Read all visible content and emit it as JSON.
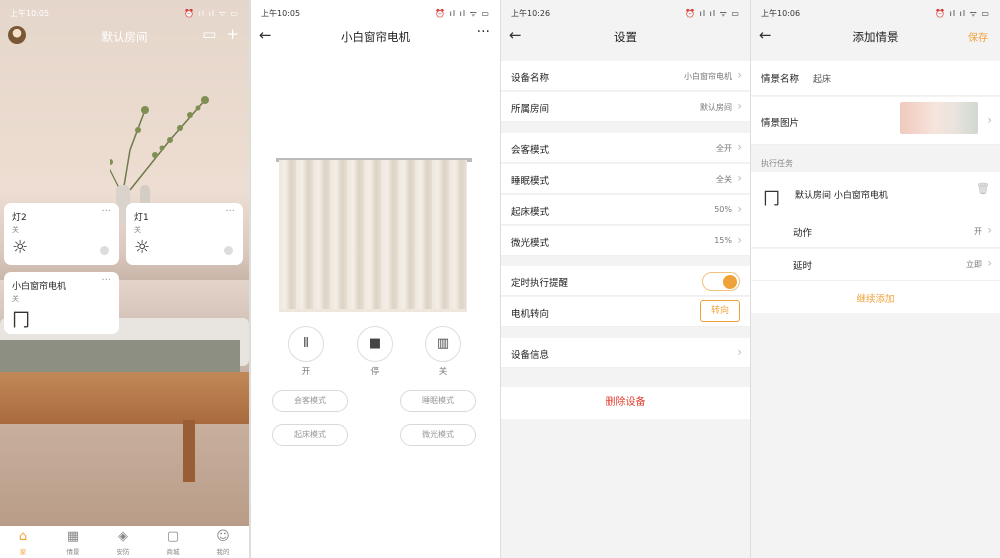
{
  "screens": {
    "home": {
      "status": {
        "time": "上午10:05",
        "right": "⏰ ıl ıl ᯤ ▭"
      },
      "title": "默认房间",
      "devices": [
        {
          "name": "灯2",
          "state": "关"
        },
        {
          "name": "灯1",
          "state": "关"
        },
        {
          "name": "小白窗帘电机",
          "state": "关"
        }
      ],
      "tabs": [
        "家",
        "情景",
        "安防",
        "商城",
        "我的"
      ]
    },
    "curtain": {
      "status": {
        "time": "上午10:05",
        "right": "⏰ ıl ıl ᯤ ▭"
      },
      "title": "小白窗帘电机",
      "controls": [
        "开",
        "停",
        "关"
      ],
      "modes": [
        "会客模式",
        "睡眠模式",
        "起床模式",
        "微光模式"
      ]
    },
    "settings": {
      "status": {
        "time": "上午10:26",
        "right": "⏰ ıl ıl ᯤ ▭"
      },
      "title": "设置",
      "rows": [
        {
          "label": "设备名称",
          "value": "小白窗帘电机"
        },
        {
          "label": "所属房间",
          "value": "默认房间"
        },
        {
          "label": "会客模式",
          "value": "全开"
        },
        {
          "label": "睡眠模式",
          "value": "全关"
        },
        {
          "label": "起床模式",
          "value": "50%"
        },
        {
          "label": "微光模式",
          "value": "15%"
        }
      ],
      "timer_label": "定时执行提醒",
      "motor_label": "电机转向",
      "motor_button": "转向",
      "info_label": "设备信息",
      "delete_label": "删除设备"
    },
    "scene": {
      "status": {
        "time": "上午10:06",
        "right": "⏰ ıl ıl ᯤ ▭"
      },
      "title": "添加情景",
      "save": "保存",
      "name_label": "情景名称",
      "name_value": "起床",
      "image_label": "情景图片",
      "task_section": "执行任务",
      "task_title": "默认房间 小白窗帘电机",
      "action_label": "动作",
      "action_value": "开",
      "delay_label": "延时",
      "delay_value": "立即",
      "add_more": "继续添加"
    }
  },
  "colors": {
    "accent": "#f0a23a",
    "danger": "#e23b2e"
  }
}
